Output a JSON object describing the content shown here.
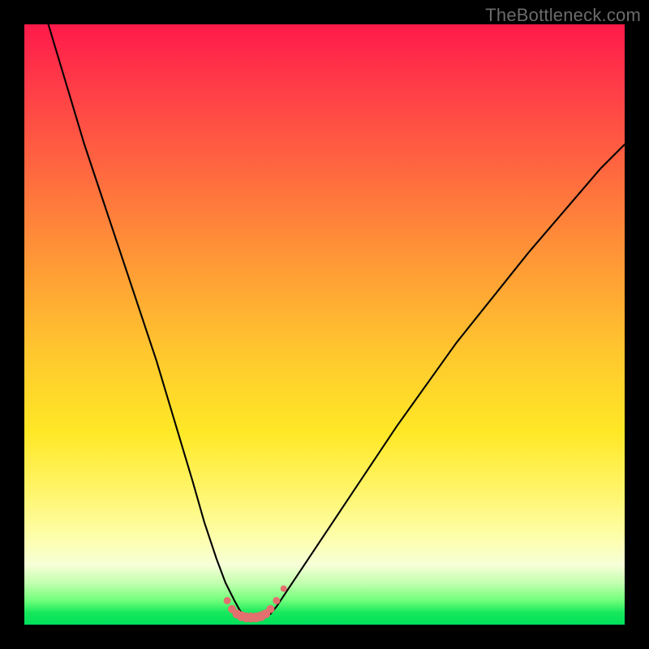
{
  "watermark": {
    "text": "TheBottleneck.com"
  },
  "chart_data": {
    "type": "line",
    "title": "",
    "xlabel": "",
    "ylabel": "",
    "xlim": [
      0,
      100
    ],
    "ylim": [
      0,
      100
    ],
    "grid": false,
    "legend": false,
    "series": [
      {
        "name": "bottleneck-curve",
        "color": "#000000",
        "x": [
          4,
          7,
          10,
          14,
          18,
          22,
          25,
          28,
          30,
          32,
          33.5,
          35,
          36,
          37,
          38,
          39,
          40,
          41,
          42,
          44,
          48,
          54,
          62,
          72,
          84,
          96,
          100
        ],
        "y": [
          100,
          90,
          80,
          68,
          56,
          44,
          34,
          24,
          17,
          11,
          7,
          4,
          2.2,
          1.3,
          1.0,
          1.0,
          1.2,
          1.8,
          3,
          6,
          12,
          21,
          33,
          47,
          62,
          76,
          80
        ]
      }
    ],
    "markers": [
      {
        "name": "trough-dots",
        "color": "#e2706e",
        "shape": "circle",
        "x": [
          33.8,
          34.6,
          35.4,
          36.2,
          37.0,
          37.8,
          38.6,
          39.4,
          40.2,
          41.0,
          42.0,
          43.2
        ],
        "y": [
          4.0,
          2.6,
          1.8,
          1.4,
          1.2,
          1.2,
          1.2,
          1.4,
          1.8,
          2.6,
          4.0,
          6.0
        ],
        "r": [
          4.5,
          5,
          5.5,
          6,
          6,
          6,
          6,
          6,
          5.5,
          5,
          4.5,
          4
        ]
      }
    ],
    "background_gradient": {
      "stops": [
        {
          "pos": 0.0,
          "color": "#ff1a4a"
        },
        {
          "pos": 0.55,
          "color": "#ffe826"
        },
        {
          "pos": 0.9,
          "color": "#f7ffd8"
        },
        {
          "pos": 1.0,
          "color": "#00e05a"
        }
      ]
    }
  }
}
